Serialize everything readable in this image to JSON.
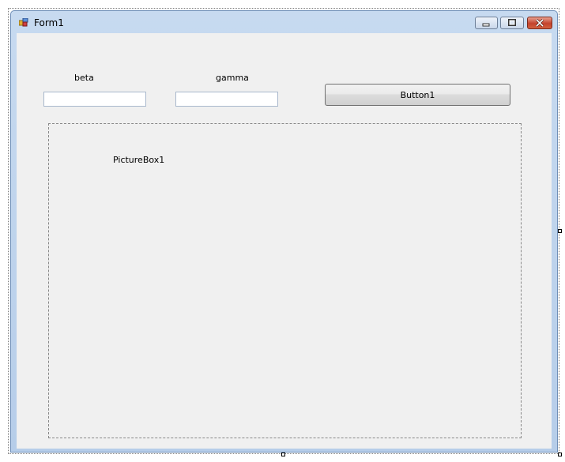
{
  "window": {
    "title": "Form1",
    "title_icon": "form-app-icon",
    "controls": {
      "minimize_icon": "minimize-icon",
      "maximize_icon": "maximize-icon",
      "close_icon": "close-icon"
    }
  },
  "form": {
    "beta_label": "beta",
    "beta_value": "",
    "gamma_label": "gamma",
    "gamma_value": "",
    "button_label": "Button1",
    "picturebox_label": "PictureBox1"
  },
  "colors": {
    "client_background": "#f0f0f0",
    "frame": "#b9d1ea",
    "close_button": "#c4432d"
  }
}
